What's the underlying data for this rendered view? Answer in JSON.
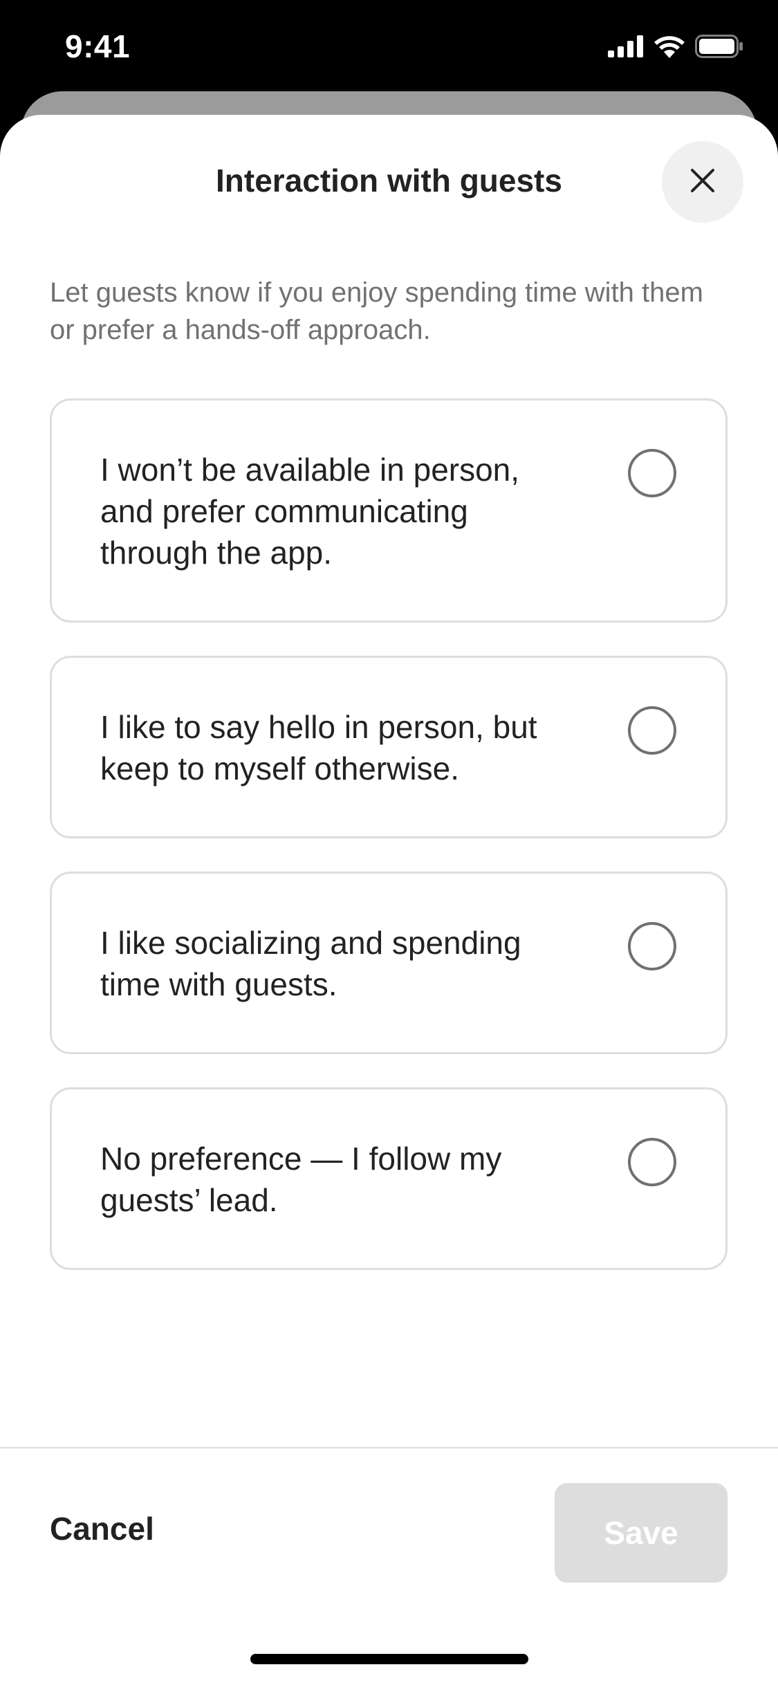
{
  "status_bar": {
    "time": "9:41",
    "icons": [
      "cellular-signal-icon",
      "wifi-icon",
      "battery-icon"
    ]
  },
  "sheet": {
    "title": "Interaction with guests",
    "close_icon": "close-icon",
    "subtitle": "Let guests know if you enjoy spending time with them or prefer a hands-off approach.",
    "options": [
      {
        "label": "I won’t be available in person, and prefer communicating through the app.",
        "selected": false
      },
      {
        "label": "I like to say hello in person, but keep to myself otherwise.",
        "selected": false
      },
      {
        "label": "I like socializing and spending time with guests.",
        "selected": false
      },
      {
        "label": "No preference — I follow my guests’ lead.",
        "selected": false
      }
    ]
  },
  "footer": {
    "cancel_label": "Cancel",
    "save_label": "Save",
    "save_enabled": false
  },
  "colors": {
    "text_primary": "#222222",
    "text_secondary": "#717171",
    "border": "#dddddd",
    "disabled_button": "#dddddd"
  }
}
